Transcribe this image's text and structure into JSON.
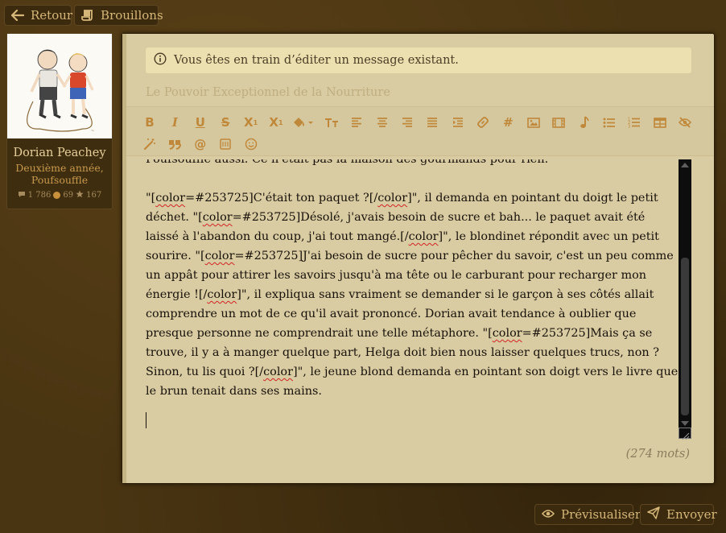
{
  "nav": {
    "back_label": "Retour",
    "drafts_label": "Brouillons"
  },
  "profile": {
    "name": "Dorian Peachey",
    "role_line1": "Deuxième année,",
    "role_line2": "Poufsouffle",
    "messages": "1 786",
    "points": "69",
    "stars": "167"
  },
  "editor": {
    "notice": "Vous êtes en train d’éditer un message existant.",
    "title_value": "Le Pouvoir Exceptionnel de la Nourriture",
    "word_count": "(274 mots)",
    "paragraph1_cut": "Poufsouffle aussi. Ce n'était pas la maison des gourmands pour rien.",
    "p2": {
      "a": "\"[",
      "b": "color",
      "c": "=#253725]C'était ton paquet ?[/",
      "d": "color",
      "e": "]\", il demanda en pointant du doigt le petit déchet. \"[",
      "f": "color",
      "g": "=#253725]Désolé, j'avais besoin de sucre et bah... le paquet avait été laissé à l'abandon du coup, j'ai tout mangé.[/",
      "h": "color",
      "i": "]\", le blondinet répondit avec un petit sourire. \"[",
      "j": "color",
      "k": "=#253725]J'ai besoin de sucre pour pêcher du savoir, c'est un peu comme un appât pour attirer les savoirs jusqu'à ma tête ou le carburant pour recharger mon énergie ![/",
      "l": "color",
      "m": "]\", il expliqua sans vraiment se demander si le garçon à ses côtés allait comprendre un mot de ce qu'il avait prononcé. Dorian avait tendance à oublier que presque personne ne comprendrait une telle métaphore. \"[",
      "n": "color",
      "o": "=#253725]Mais ça se trouve, il y a à manger quelque part, Helga doit bien nous laisser quelques trucs, non ? Sinon, tu lis quoi ?[/",
      "p": "color",
      "q": "]\", le jeune blond demanda en pointant son doigt vers le livre que le brun tenait dans ses mains."
    }
  },
  "actions": {
    "preview_label": "Prévisualiser",
    "send_label": "Envoyer"
  },
  "colors": {
    "accent": "#c0883a",
    "panel_bg": "#d9cba2",
    "page_bg": "#4a3512"
  }
}
